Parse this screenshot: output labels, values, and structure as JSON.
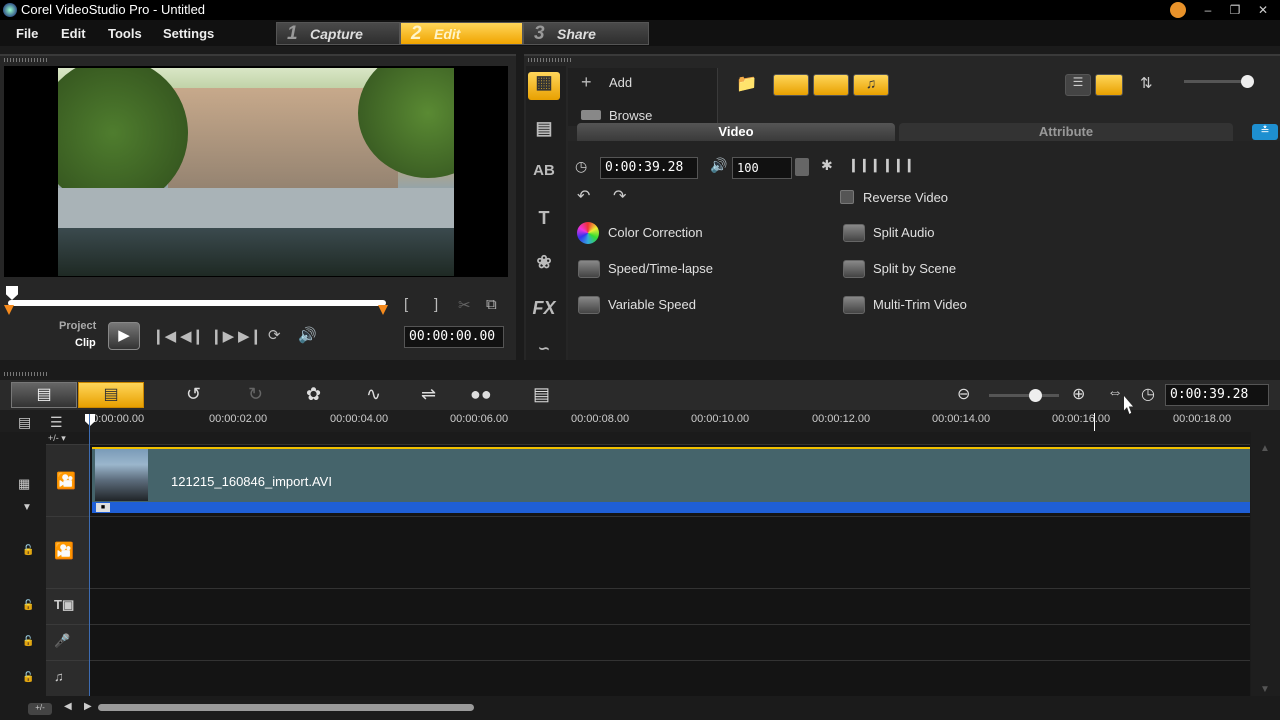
{
  "window": {
    "title": "Corel VideoStudio Pro - Untitled"
  },
  "menu": [
    "File",
    "Edit",
    "Tools",
    "Settings"
  ],
  "steps": [
    {
      "num": "1",
      "label": "Capture"
    },
    {
      "num": "2",
      "label": "Edit"
    },
    {
      "num": "3",
      "label": "Share"
    }
  ],
  "preview": {
    "mode_project": "Project",
    "mode_clip": "Clip",
    "timecode": "00:00:00.00",
    "mark_in": "[",
    "mark_out": "]"
  },
  "library": {
    "add_label": "Add",
    "browse_label": "Browse",
    "tabs": [
      "Video",
      "Attribute"
    ],
    "duration": "0:00:39.28",
    "volume": "100",
    "options_left": [
      "Color Correction",
      "Speed/Time-lapse",
      "Variable Speed"
    ],
    "options_right": [
      "Reverse Video",
      "Split Audio",
      "Split by Scene",
      "Multi-Trim Video"
    ]
  },
  "timeline": {
    "project_duration": "0:00:39.28",
    "ruler": [
      "00:00:00.00",
      "00:00:02.00",
      "00:00:04.00",
      "00:00:06.00",
      "00:00:08.00",
      "00:00:10.00",
      "00:00:12.00",
      "00:00:14.00",
      "00:00:16.00",
      "00:00:18.00"
    ],
    "clip_name": "121215_160846_import.AVI"
  }
}
